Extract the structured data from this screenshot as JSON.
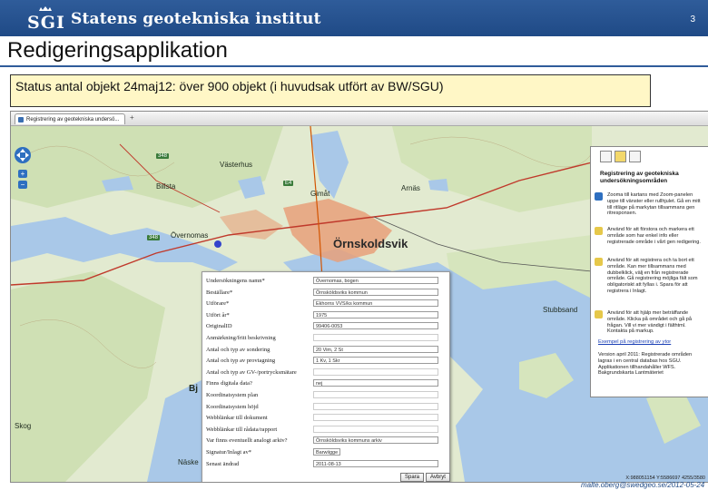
{
  "header": {
    "logo_letters": "SGI",
    "org_name": "Statens geotekniska institut",
    "page_number": "3"
  },
  "title": "Redigeringsapplikation",
  "status": "Status antal objekt 24maj12: över 900 objekt (i huvudsak utfört av BW/SGU)",
  "browser": {
    "tab_label": "Registrering av geotekniska undersö...",
    "tab_add": "+"
  },
  "map": {
    "places": {
      "billsta": "Billsta",
      "vasterhus": "Västerhus",
      "gimat": "Gimåt",
      "arnas": "Arnäs",
      "overnomas": "Övernomas",
      "ornskoldsvik": "Örnskoldsvik",
      "bjurstad": "Bj",
      "stubbsand": "Stubbsand",
      "skog": "Skog",
      "naske": "Näske"
    },
    "road_numbers": [
      "348",
      "348",
      "E4"
    ],
    "zoom_in": "+",
    "zoom_out": "−",
    "coords": "X:988051154 Y:5586697  4255/3580"
  },
  "form": {
    "fields": [
      {
        "label": "Undersökningens namn*",
        "value": "Övernomas, bogen"
      },
      {
        "label": "Beställare*",
        "value": "Örnsköldsviks kommun"
      },
      {
        "label": "Utförare*",
        "value": "Ekhorns VVS/ks kommun"
      },
      {
        "label": "Utfört år*",
        "value": "1975"
      },
      {
        "label": "OriginalID",
        "value": "99406-0053"
      },
      {
        "label": "Anmärkning/fritt beskrivning",
        "value": ""
      },
      {
        "label": "Antal och typ av sondering",
        "value": "20 Vim, 2 St"
      },
      {
        "label": "Antal och typ av provtagning",
        "value": "1 Kv, 1 Skr"
      },
      {
        "label": "Antal och typ av GV-/portrycksmätare",
        "value": ""
      },
      {
        "label": "Finns digitala data?",
        "value": "nej"
      },
      {
        "label": "Koordinatsystem plan",
        "value": ""
      },
      {
        "label": "Koordinatsystem höjd",
        "value": ""
      },
      {
        "label": "Webblänkar till dokument",
        "value": ""
      },
      {
        "label": "Webblänkar till rådata/rapport",
        "value": ""
      },
      {
        "label": "Var finns eventuellt analogt arkiv?",
        "value": "Örnsköldsviks kommuns arkiv"
      },
      {
        "label": "Signatur/Inlagt av*",
        "value": "Barwiigge"
      },
      {
        "label": "Senast ändrad",
        "value": "2011-08-13"
      }
    ],
    "save_label": "Spara",
    "cancel_label": "Avbryt"
  },
  "panel": {
    "title": "Registrering av geotekniska undersökningsområden",
    "blocks": [
      "Zooma till kartans med Zoom-panelen uppe till vänster eller rullhjulet. Gå en mitt till ritläge på markytan tillsammans gen ritresponsen.",
      "Använd för att förstora och markera ett område som har enkel info eller registrerade område i vårt gen redigering.",
      "Använd för att registrera och ta bort ett område. Kan mer tillsammans med dubbelklick, välj en från registrerade område. Gå registrering möjliga fält som obligatoriskt att fyllas i. Spara för att registrera i Inlagt.",
      "Använd för att hjälp mer beträffande område. Klicka på området och gå på frågan. Vill vi mer vändigt i fälthtml. Kontakta på markup."
    ],
    "link": "Exempel på registrering av ytor",
    "version_note": "Version april 2011: Registrerade områden lagras i en central databas hos SGU. Applikationen tillhandahåller WFS. Bakgrundskarta Lantmäteriet"
  },
  "footer_email": "malte.oberg@swedgeo.se/2012-05-24",
  "colors": {
    "banner": "#2f5c9a",
    "status_bg": "#fff7c6",
    "water": "#a9c8e8",
    "land": "#e7edd4",
    "forest": "#c9dcae",
    "urban": "#e8a07a"
  }
}
